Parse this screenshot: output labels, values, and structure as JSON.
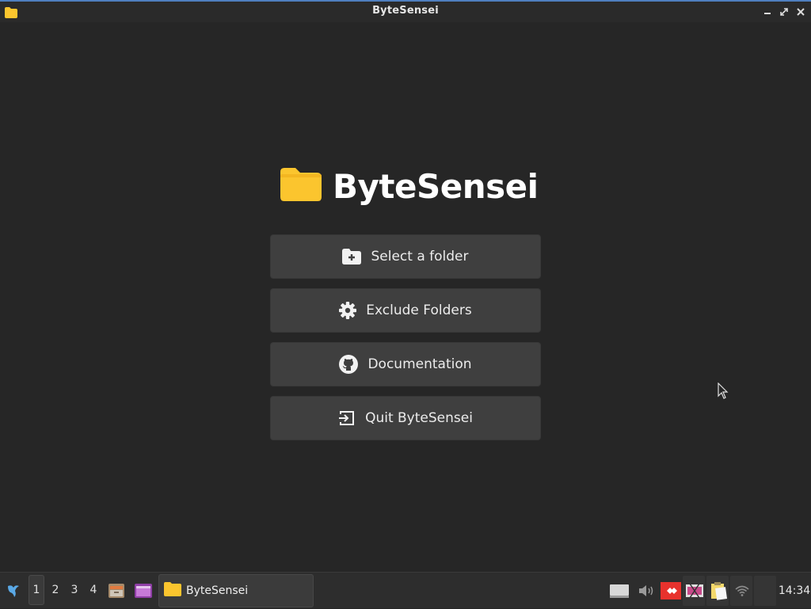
{
  "window": {
    "title": "ByteSensei"
  },
  "brand": {
    "name": "ByteSensei"
  },
  "buttons": [
    {
      "label": "Select a folder",
      "icon": "folder-plus-icon"
    },
    {
      "label": "Exclude Folders",
      "icon": "gear-icon"
    },
    {
      "label": "Documentation",
      "icon": "github-icon"
    },
    {
      "label": "Quit ByteSensei",
      "icon": "exit-icon"
    }
  ],
  "taskbar": {
    "workspaces": [
      "1",
      "2",
      "3",
      "4"
    ],
    "active_workspace": "1",
    "task_label": "ByteSensei",
    "clock": "14:34"
  },
  "colors": {
    "background": "#262626",
    "button": "#3f3f3f",
    "folder_yellow": "#fbc52e",
    "accent_blue": "#4f7fbf"
  }
}
